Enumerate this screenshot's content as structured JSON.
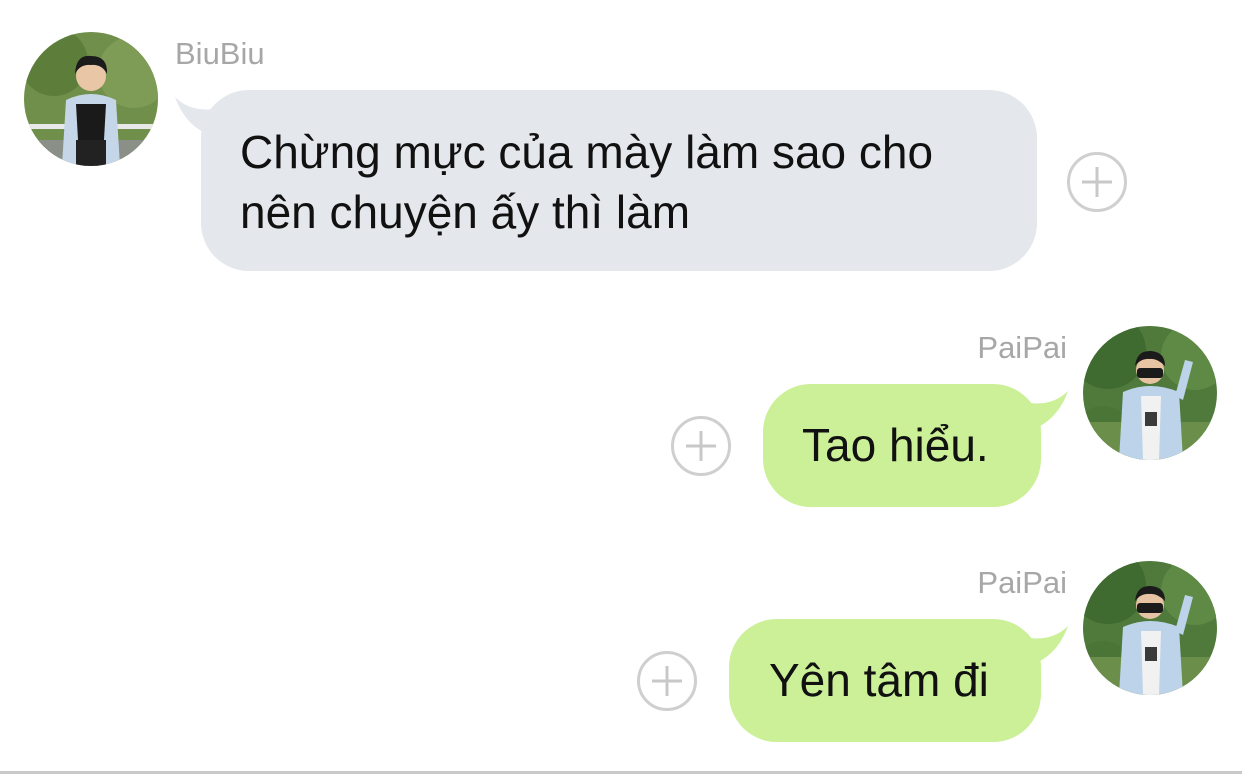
{
  "colors": {
    "incoming_bubble": "#e4e7eb",
    "outgoing_bubble": "#cbf098",
    "sender_name": "#a7a7a7",
    "background": "#ffffff"
  },
  "messages": [
    {
      "sender": "BiuBiu",
      "direction": "incoming",
      "text": "Chừng mực của mày làm sao cho nên chuyện ấy thì làm",
      "avatar_icon": "user-avatar-icon",
      "reaction_icon": "add-reaction-icon"
    },
    {
      "sender": "PaiPai",
      "direction": "outgoing",
      "text": "Tao hiểu.",
      "avatar_icon": "user-avatar-icon",
      "reaction_icon": "add-reaction-icon"
    },
    {
      "sender": "PaiPai",
      "direction": "outgoing",
      "text": "Yên tâm đi",
      "avatar_icon": "user-avatar-icon",
      "reaction_icon": "add-reaction-icon"
    }
  ]
}
